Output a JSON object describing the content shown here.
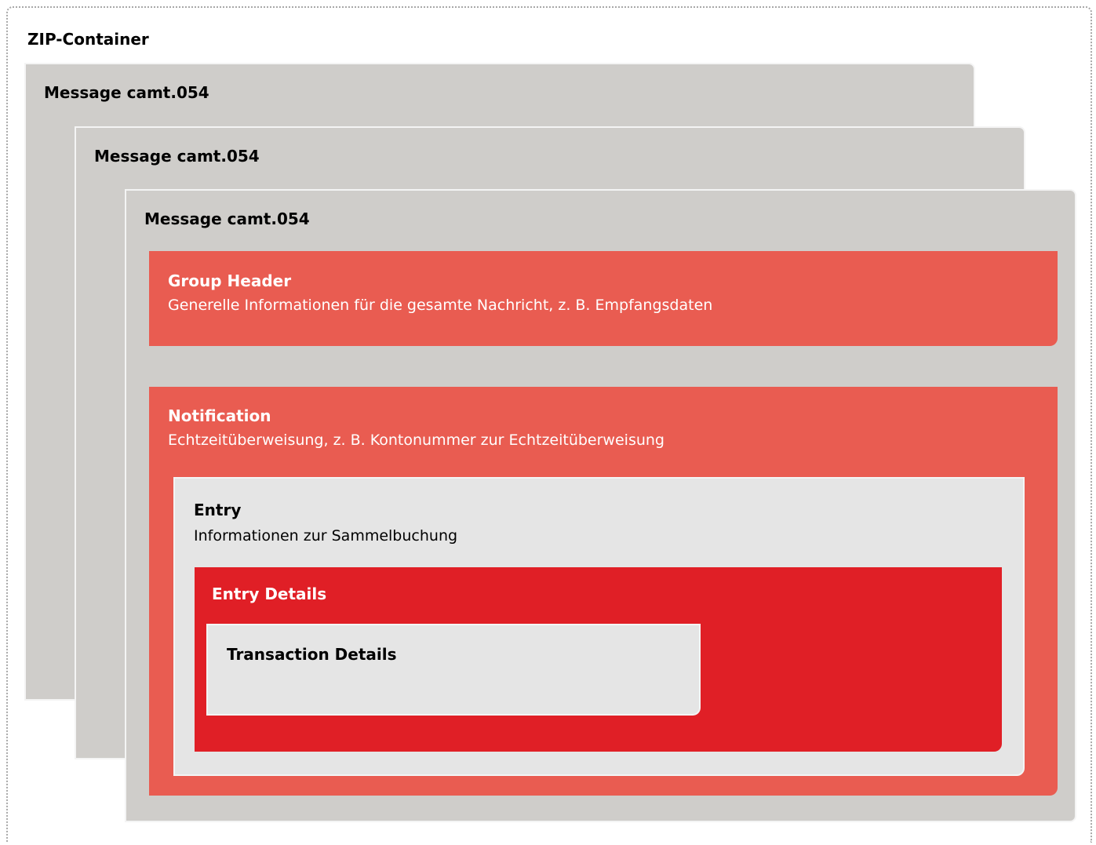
{
  "container": {
    "title": "ZIP-Container"
  },
  "messages": [
    {
      "title": "Message camt.054"
    },
    {
      "title": "Message camt.054"
    },
    {
      "title": "Message camt.054"
    }
  ],
  "group_header": {
    "title": "Group Header",
    "description": "Generelle Informationen für die gesamte Nachricht, z. B. Empfangsdaten"
  },
  "notification": {
    "title": "Notification",
    "description": "Echtzeitüberweisung, z. B. Kontonummer zur Echtzeitüberweisung"
  },
  "entry": {
    "title": "Entry",
    "description": "Informationen zur Sammelbuchung"
  },
  "entry_details": {
    "title": "Entry Details"
  },
  "transaction_details": {
    "title": "Transaction Details"
  },
  "colors": {
    "message_bg": "#cfcdca",
    "block_red_light": "#e95c51",
    "block_red_dark": "#e01f26",
    "block_grey": "#e5e5e5"
  }
}
